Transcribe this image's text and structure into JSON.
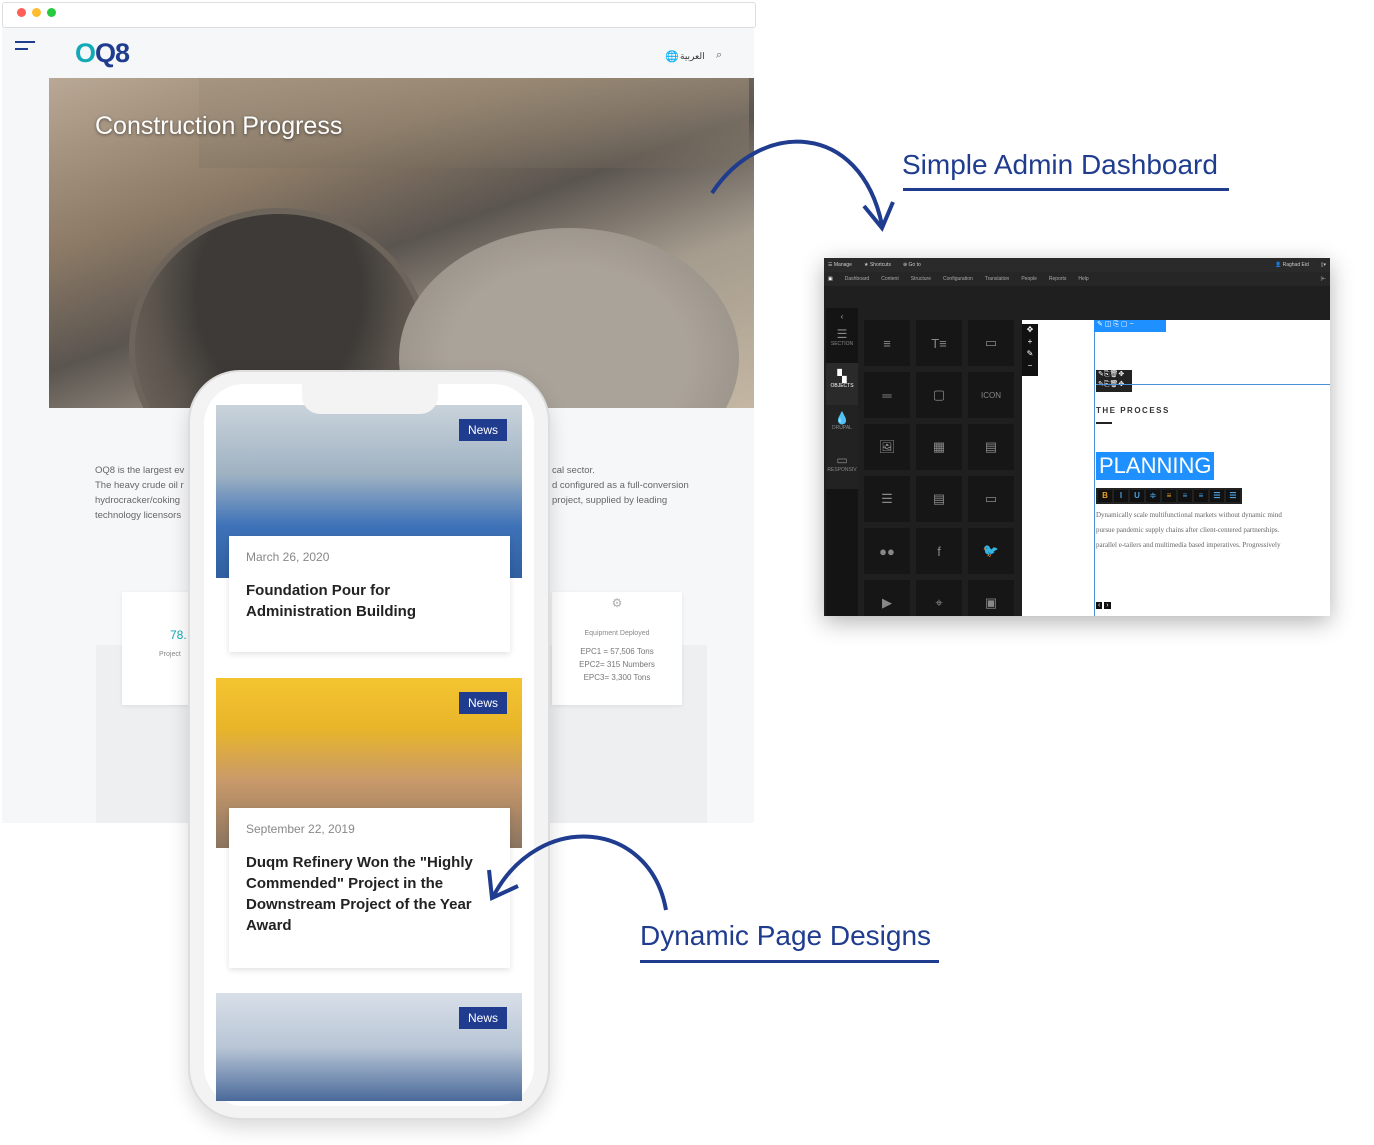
{
  "browser": {
    "dots": [
      "#ff5f56",
      "#ffbd2e",
      "#27c93f"
    ]
  },
  "site": {
    "logo": {
      "o": "O",
      "rest": "Q8"
    },
    "language": "العربية",
    "icons": [
      "menu-icon",
      "globe-icon",
      "search-icon"
    ],
    "hero_title": "Construction Progress",
    "paragraph_left": [
      "OQ8 is the largest ev",
      "The heavy crude oil r",
      "hydrocracker/coking",
      "technology licensors"
    ],
    "paragraph_right": [
      "cal sector.",
      "d configured as a full-conversion",
      "project, supplied by leading"
    ],
    "stat_left": {
      "value": "78.",
      "label": "Project"
    },
    "stat_right": {
      "label": "Equipment Deployed",
      "lines": [
        "EPC1 = 57,506 Tons",
        "EPC2= 315 Numbers",
        "EPC3= 3,300 Tons"
      ]
    }
  },
  "phone": {
    "news": [
      {
        "badge": "News",
        "date": "March 26, 2020",
        "title": "Foundation Pour for Administration Building"
      },
      {
        "badge": "News",
        "date": "September 22, 2019",
        "title": "Duqm Refinery Won the \"Highly Commended\" Project in the Downstream Project of the Year Award"
      },
      {
        "badge": "News"
      }
    ]
  },
  "admin": {
    "toolbar_top": {
      "manage": "Manage",
      "shortcuts": "Shortcuts",
      "goto": "Go to",
      "user": "Raghad Eid"
    },
    "toolbar_menu": [
      "Dashboard",
      "Content",
      "Structure",
      "Configuration",
      "Translation",
      "People",
      "Reports",
      "Help"
    ],
    "sidebar": [
      {
        "label": "SECTION"
      },
      {
        "label": "OBJECTS"
      },
      {
        "label": "DRUPAL"
      },
      {
        "label": "RESPONSIV"
      }
    ],
    "tiles": [
      "≡",
      "T≡",
      "▭",
      "═",
      "▢",
      "ICON",
      "🖼",
      "▦",
      "▤",
      "☰",
      "▤",
      "▭",
      "●●",
      "f",
      "🐦",
      "▶",
      "⌖",
      "▣"
    ],
    "canvas": {
      "eyebrow": "THE PROCESS",
      "heading": "PLANNING",
      "format_buttons": [
        "B",
        "I",
        "U",
        "≑",
        "≡",
        "≡",
        "≡",
        "☰",
        "☰"
      ],
      "body": [
        "Dynamically scale multifunctional markets without dynamic mind",
        "pursue pandemic supply chains after client-centered partnerships.",
        "parallel e-tailers and multimedia based imperatives. Progressively"
      ]
    }
  },
  "callouts": {
    "admin": "Simple Admin Dashboard",
    "pages": "Dynamic Page Designs"
  },
  "colors": {
    "brand": "#1f3c8f",
    "teal": "#13aab8",
    "highlight": "#1e90ff"
  }
}
